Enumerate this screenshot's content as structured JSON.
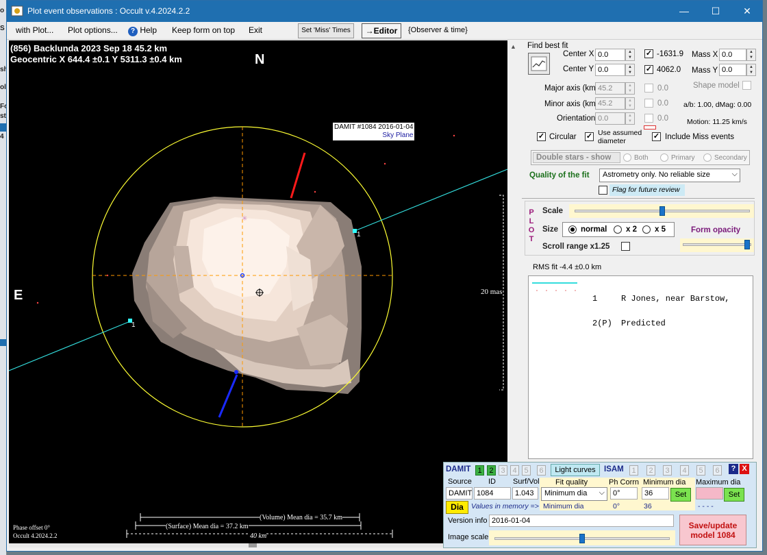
{
  "background_window": {
    "fragments": [
      "o",
      "S",
      "sh",
      "ol",
      "Fo",
      "st",
      "4"
    ]
  },
  "window": {
    "title": "Plot event observations : Occult v.4.2024.2.2",
    "controls": {
      "minimize": "—",
      "maximize": "☐",
      "close": "✕"
    }
  },
  "menu": {
    "with_plot": "with Plot...",
    "plot_options": "Plot options...",
    "help": "Help",
    "keep_form": "Keep form on top",
    "exit": "Exit",
    "set_miss_times": "Set 'Miss' Times",
    "editor": "→Editor",
    "observer_time": "{Observer & time}"
  },
  "plot": {
    "line1": "(856) Backlunda  2023 Sep 18  45.2 km",
    "line2": "Geocentric  X  644.4 ±0.1  Y 5311.3 ±0.4 km",
    "north": "N",
    "east": "E",
    "damit_label": "DAMIT #1084 2016-01-04",
    "sky_plane": "Sky Plane",
    "chord_label_a": "1",
    "chord_label_b": "1",
    "scale_mas": "20 mas",
    "volume_dia": "(Volume) Mean dia = 35.7 km",
    "surface_dia": "(Surface) Mean dia = 37.2 km",
    "km_scale": "40 km",
    "phase_offset": "Phase offset 0°",
    "version": "Occult 4.2024.2.2",
    "colors": {
      "circle": "#ffff33",
      "chord": "#33dddd",
      "dashed_axes": "#ff9900",
      "red_arrow": "#ff1a1a",
      "blue_arrow": "#1a2aff"
    }
  },
  "find_best_fit": {
    "group_label": "Find best fit",
    "center_x_label": "Center X",
    "center_x": "0.0",
    "center_y_label": "Center Y",
    "center_y": "0.0",
    "val_x": "-1631.9",
    "val_y": "4062.0",
    "mass_x_label": "Mass X",
    "mass_x": "0.0",
    "mass_y_label": "Mass Y",
    "mass_y": "0.0",
    "major_axis_label": "Major axis (km)",
    "major_axis": "45.2",
    "minor_axis_label": "Minor axis (km)",
    "minor_axis": "45.2",
    "orientation_label": "Orientation",
    "orientation": "0.0",
    "zero_a": "0.0",
    "zero_b": "0.0",
    "zero_c": "0.0",
    "shape_model_label": "Shape model",
    "ab_dmag": "a/b: 1.00, dMag: 0.00",
    "motion": "Motion: 11.25 km/s",
    "circular_label": "Circular",
    "use_assumed_label": "Use assumed diameter",
    "include_miss_label": "Include Miss events",
    "double_stars_label": "Double stars - show",
    "both_label": "Both",
    "primary_label": "Primary",
    "secondary_label": "Secondary",
    "quality_label": "Quality of the fit",
    "quality_value": "Astrometry only. No reliable size",
    "flag_label": "Flag for future review"
  },
  "plot_panel": {
    "plot_letters": [
      "P",
      "L",
      "O",
      "T"
    ],
    "scale_label": "Scale",
    "size_label": "Size",
    "size_normal": "normal",
    "size_x2": "x 2",
    "size_x5": "x 5",
    "form_opacity_label": "Form opacity",
    "scroll_range_label": "Scroll range x1.25",
    "scale_level": 0.5,
    "opacity_level": 0.98
  },
  "rms_fit": "RMS fit -4.4 ±0.0 km",
  "legend": [
    {
      "id": "1",
      "name": "R Jones, near Barstow,",
      "style": "solid",
      "color": "#33dddd"
    },
    {
      "id": "2(P)",
      "name": "Predicted",
      "style": "dots",
      "color": "#e05050"
    }
  ],
  "damit_panel": {
    "damit_label": "DAMIT",
    "damit_tabs": [
      "1",
      "2",
      "3",
      "4",
      "5",
      "6"
    ],
    "light_curves": "Light curves",
    "isam_label": "ISAM",
    "isam_tabs": [
      "1",
      "2",
      "3",
      "4",
      "5",
      "6"
    ],
    "help": "?",
    "close": "X",
    "source_label": "Source",
    "id_label": "ID",
    "surf_vol_label": "Surf/Vol",
    "source": "DAMIT",
    "id": "1084",
    "surf_vol": "1.043",
    "fit_quality_label": "Fit quality",
    "fit_quality": "Minimum dia",
    "ph_corr_label": "Ph Corrn",
    "ph_corr": "0°",
    "min_dia_label": "Minimum dia",
    "min_dia": "36",
    "max_dia_label": "Maximum dia",
    "set1": "Set",
    "set2": "Set",
    "dia_btn": "Dia",
    "values_in_memory": "Values in memory =>",
    "mem_fit": "Minimum dia",
    "mem_ph": "0°",
    "mem_min": "36",
    "mem_max": "- - - -",
    "version_info_label": "Version info",
    "version_info": "2016-01-04",
    "image_scale_label": "Image scale",
    "save_update": "Save/update model  1084",
    "image_scale_level": 0.5
  }
}
